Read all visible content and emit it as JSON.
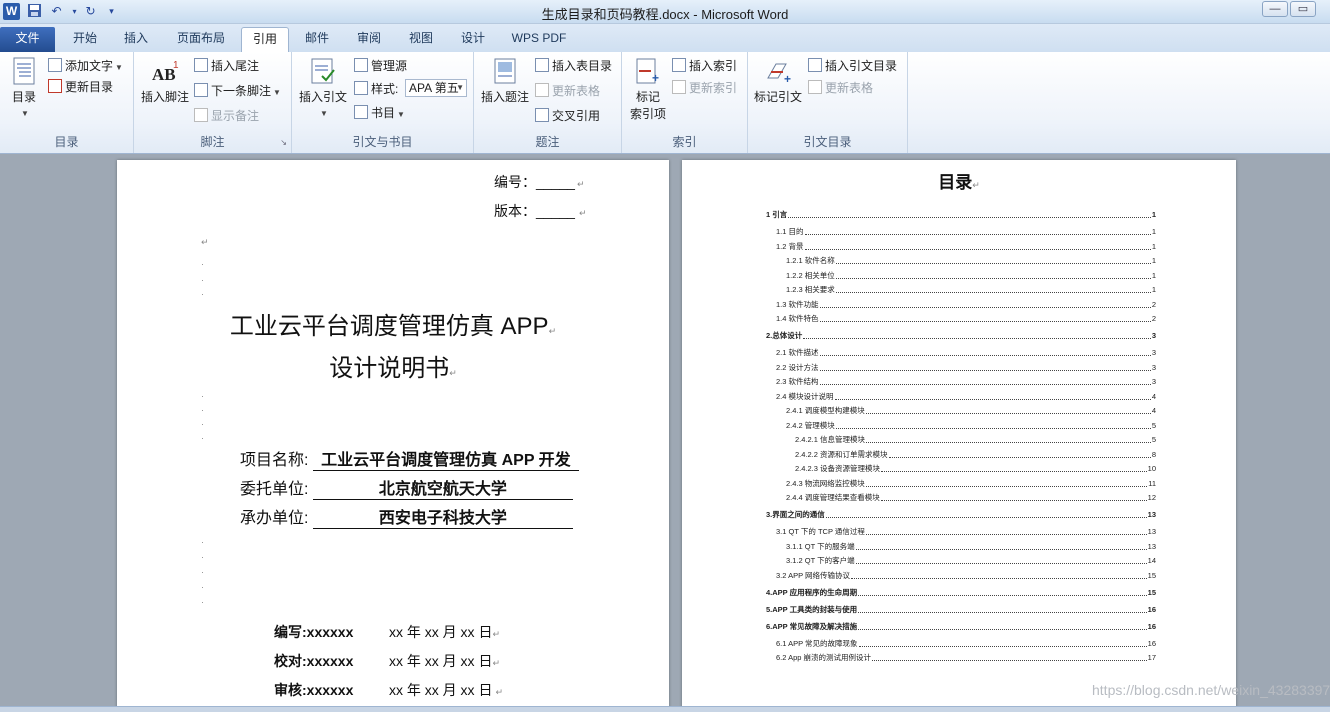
{
  "window": {
    "title": "生成目录和页码教程.docx - Microsoft Word",
    "logo": "W",
    "minimize_label": "—",
    "maximize_label": "▭"
  },
  "quick_access": {
    "save_icon": "save-icon",
    "undo_icon": "undo-icon",
    "redo_icon": "redo-icon",
    "customize_icon": "customize-icon"
  },
  "tabs": [
    "文件",
    "开始",
    "插入",
    "页面布局",
    "引用",
    "邮件",
    "审阅",
    "视图",
    "设计",
    "WPS PDF"
  ],
  "active_tab": "引用",
  "ribbon": {
    "toc_group": {
      "label": "目录",
      "toc_button": "目录",
      "add_text": "添加文字",
      "update_toc": "更新目录"
    },
    "footnote_group": {
      "label": "脚注",
      "insert_footnote": "插入脚注",
      "insert_endnote": "插入尾注",
      "next_footnote": "下一条脚注",
      "show_notes": "显示备注"
    },
    "citation_group": {
      "label": "引文与书目",
      "insert_citation": "插入引文",
      "manage_sources": "管理源",
      "style_label": "样式:",
      "style_value": "APA 第五",
      "bibliography": "书目"
    },
    "caption_group": {
      "label": "题注",
      "insert_caption": "插入题注",
      "insert_table_of_figures": "插入表目录",
      "update_table": "更新表格",
      "cross_reference": "交叉引用"
    },
    "index_group": {
      "label": "索引",
      "mark_entry_line1": "标记",
      "mark_entry_line2": "索引项",
      "insert_index": "插入索引",
      "update_index": "更新索引"
    },
    "authorities_group": {
      "label": "引文目录",
      "mark_citation": "标记引文",
      "insert_authorities": "插入引文目录",
      "update_table": "更新表格"
    }
  },
  "cover": {
    "number_label": "编号：_____",
    "version_label": "版本：_____",
    "title_line1": "工业云平台调度管理仿真 APP",
    "title_line2": "设计说明书",
    "project_label": "项目名称:",
    "project_value": "工业云平台调度管理仿真 APP 开发",
    "client_label": "委托单位:",
    "client_value": "北京航空航天大学",
    "contractor_label": "承办单位:",
    "contractor_value": "西安电子科技大学",
    "signoffs": [
      {
        "label": "编写:xxxxxx",
        "date": "xx 年 xx 月 xx 日"
      },
      {
        "label": "校对:xxxxxx",
        "date": "xx 年 xx 月 xx 日"
      },
      {
        "label": "审核:xxxxxx",
        "date": "xx 年 xx 月 xx 日"
      }
    ],
    "paragraph_mark": "↵"
  },
  "toc": {
    "title": "目录",
    "entries": [
      {
        "text": "1 引言",
        "page": "1",
        "level": 1
      },
      {
        "text": "1.1 目的",
        "page": "1",
        "level": 2
      },
      {
        "text": "1.2 背景",
        "page": "1",
        "level": 2
      },
      {
        "text": "1.2.1 软件名称",
        "page": "1",
        "level": 3
      },
      {
        "text": "1.2.2 相关单位",
        "page": "1",
        "level": 3
      },
      {
        "text": "1.2.3 相关要求",
        "page": "1",
        "level": 3
      },
      {
        "text": "1.3 软件功能",
        "page": "2",
        "level": 2
      },
      {
        "text": "1.4 软件特色",
        "page": "2",
        "level": 2
      },
      {
        "text": "2.总体设计",
        "page": "3",
        "level": 1
      },
      {
        "text": "2.1 软件描述",
        "page": "3",
        "level": 2
      },
      {
        "text": "2.2 设计方法",
        "page": "3",
        "level": 2
      },
      {
        "text": "2.3 软件结构",
        "page": "3",
        "level": 2
      },
      {
        "text": "2.4 模块设计说明",
        "page": "4",
        "level": 2
      },
      {
        "text": "2.4.1 调度模型构建模块",
        "page": "4",
        "level": 3
      },
      {
        "text": "2.4.2 管理模块",
        "page": "5",
        "level": 3
      },
      {
        "text": "2.4.2.1 信息管理模块",
        "page": "5",
        "level": 4
      },
      {
        "text": "2.4.2.2 资源和订单需求模块",
        "page": "8",
        "level": 4
      },
      {
        "text": "2.4.2.3 设备资源管理模块",
        "page": "10",
        "level": 4
      },
      {
        "text": "2.4.3 物流网络监控模块",
        "page": "11",
        "level": 3
      },
      {
        "text": "2.4.4 调度管理结果查看模块",
        "page": "12",
        "level": 3
      },
      {
        "text": "3.界面之间的通信",
        "page": "13",
        "level": 1
      },
      {
        "text": "3.1 QT 下的 TCP 通信过程",
        "page": "13",
        "level": 2
      },
      {
        "text": "3.1.1 QT 下的服务端",
        "page": "13",
        "level": 3
      },
      {
        "text": "3.1.2 QT 下的客户端",
        "page": "14",
        "level": 3
      },
      {
        "text": "3.2 APP 网络传输协议",
        "page": "15",
        "level": 2
      },
      {
        "text": "4.APP 应用程序的生命周期",
        "page": "15",
        "level": 1
      },
      {
        "text": "5.APP 工具类的封装与使用",
        "page": "16",
        "level": 1
      },
      {
        "text": "6.APP 常见故障及解决措施",
        "page": "16",
        "level": 1
      },
      {
        "text": "6.1 APP 常见的故障现象",
        "page": "16",
        "level": 2
      },
      {
        "text": "6.2 App 崩溃的测试用例设计",
        "page": "17",
        "level": 2
      }
    ]
  },
  "watermark": "https://blog.csdn.net/weixin_43283397"
}
